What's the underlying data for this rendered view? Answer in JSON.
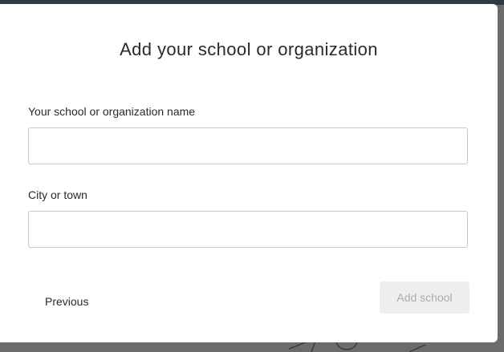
{
  "dialog": {
    "title": "Add your school or organization",
    "school_field": {
      "label": "Your school or organization name",
      "value": "",
      "placeholder": ""
    },
    "city_field": {
      "label": "City or town",
      "value": "",
      "placeholder": ""
    },
    "previous_label": "Previous",
    "add_school_label": "Add school",
    "add_school_disabled": true
  },
  "colors": {
    "overlay": "#6b6b6b",
    "topbar": "#2e3a4a",
    "disabled_button_bg": "#efefef",
    "disabled_button_text": "#a9acaf",
    "input_border": "#c8c8c8"
  }
}
